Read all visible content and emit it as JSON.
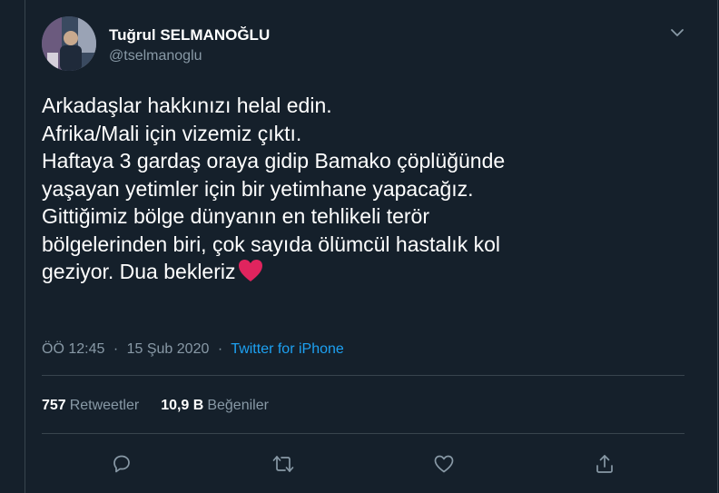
{
  "user": {
    "name": "Tuğrul SELMANOĞLU",
    "handle": "@tselmanoglu"
  },
  "tweet": {
    "lines": [
      "Arkadaşlar hakkınızı helal edin.",
      "Afrika/Mali için vizemiz çıktı.",
      "Haftaya 3 gardaş oraya gidip Bamako çöplüğünde",
      "yaşayan yetimler için bir yetimhane yapacağız.",
      "Gittiğimiz bölge dünyanın en tehlikeli terör",
      "bölgelerinden biri, çok sayıda ölümcül hastalık kol",
      "geziyor. Dua bekleriz"
    ],
    "emoji": "red-heart-icon"
  },
  "meta": {
    "time": "ÖÖ 12:45",
    "separator": "·",
    "date": "15 Şub 2020",
    "source": "Twitter for iPhone"
  },
  "stats": {
    "retweets_count": "757",
    "retweets_label": "Retweetler",
    "likes_count": "10,9 B",
    "likes_label": "Beğeniler"
  },
  "actions": [
    "reply-icon",
    "retweet-icon",
    "like-icon",
    "share-icon"
  ],
  "colors": {
    "background": "#15202b",
    "text": "#ffffff",
    "secondary": "#8899a6",
    "accent": "#1da1f2",
    "border": "#38444d",
    "heart": "#e0245e"
  }
}
